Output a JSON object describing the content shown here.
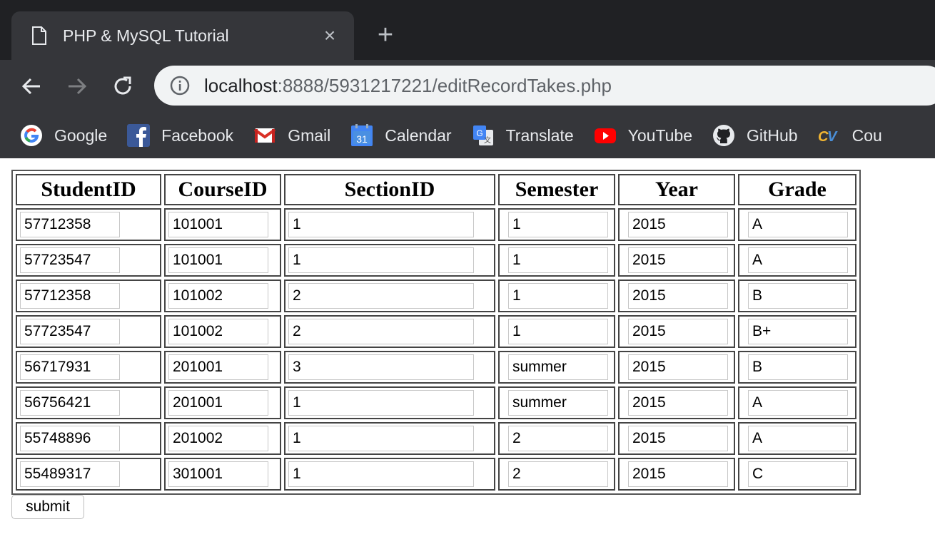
{
  "browser": {
    "tab_title": "PHP & MySQL Tutorial",
    "close_glyph": "×",
    "new_tab_glyph": "+",
    "url_host": "localhost",
    "url_rest": ":8888/5931217221/editRecordTakes.php",
    "bookmarks": [
      {
        "label": "Google",
        "icon": "google-icon"
      },
      {
        "label": "Facebook",
        "icon": "facebook-icon"
      },
      {
        "label": "Gmail",
        "icon": "gmail-icon"
      },
      {
        "label": "Calendar",
        "icon": "calendar-icon"
      },
      {
        "label": "Translate",
        "icon": "translate-icon"
      },
      {
        "label": "YouTube",
        "icon": "youtube-icon"
      },
      {
        "label": "GitHub",
        "icon": "github-icon"
      },
      {
        "label": "Cou",
        "icon": "cv-icon"
      }
    ],
    "calendar_day": "31"
  },
  "table": {
    "headers": [
      "StudentID",
      "CourseID",
      "SectionID",
      "Semester",
      "Year",
      "Grade"
    ],
    "rows": [
      [
        "57712358",
        "101001",
        "1",
        "1",
        "2015",
        "A"
      ],
      [
        "57723547",
        "101001",
        "1",
        "1",
        "2015",
        "A"
      ],
      [
        "57712358",
        "101002",
        "2",
        "1",
        "2015",
        "B"
      ],
      [
        "57723547",
        "101002",
        "2",
        "1",
        "2015",
        "B+"
      ],
      [
        "56717931",
        "201001",
        "3",
        "summer",
        "2015",
        "B"
      ],
      [
        "56756421",
        "201001",
        "1",
        "summer",
        "2015",
        "A"
      ],
      [
        "55748896",
        "201002",
        "1",
        "2",
        "2015",
        "A"
      ],
      [
        "55489317",
        "301001",
        "1",
        "2",
        "2015",
        "C"
      ]
    ]
  },
  "form": {
    "submit_label": "submit"
  }
}
